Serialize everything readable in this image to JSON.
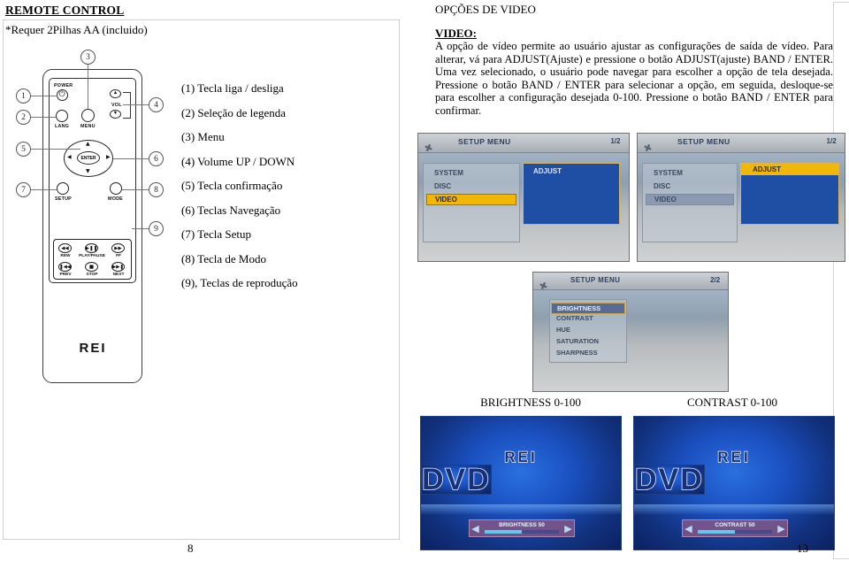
{
  "left": {
    "heading": "REMOTE CONTROL",
    "subheading": "*Requer 2Pilhas AA (incluido)",
    "page_number": "8",
    "legend": [
      "(1) Tecla liga / desliga",
      "(2) Seleção de legenda",
      "(3) Menu",
      "(4) Volume UP / DOWN",
      "(5) Tecla confirmação",
      "(6) Teclas Navegação",
      "(7) Tecla Setup",
      "(8) Tecla de Modo",
      "(9), Teclas de reprodução"
    ],
    "callouts": [
      "1",
      "2",
      "3",
      "4",
      "5",
      "6",
      "7",
      "8",
      "9"
    ],
    "remote": {
      "brand": "REI",
      "buttons": {
        "power": "POWER",
        "lang": "LANG",
        "menu": "MENU",
        "vol": "VOL",
        "enter": "ENTER",
        "setup": "SETUP",
        "mode": "MODE",
        "rew": "REW",
        "play_pause": "PLAY/PAUSE",
        "ff": "FF",
        "prev": "PREV",
        "stop": "STOP",
        "next": "NEXT"
      },
      "glyphs": {
        "power": "⏻",
        "up": "▲",
        "down": "▼",
        "left": "◀",
        "right": "▶",
        "rew": "◀◀",
        "play_pause": "▶❚❚",
        "ff": "▶▶",
        "prev": "❚◀◀",
        "stop": "■",
        "next": "▶▶❚"
      }
    }
  },
  "right": {
    "heading": "OPÇÕES DE VIDEO",
    "section_label": "VIDEO",
    "paragraph": "A opção de vídeo permite ao usuário ajustar as configurações de saída de vídeo. Para alterar, vá para ADJUST(Ajuste) e pressione o botão ADJUST(ajuste) BAND / ENTER. Uma vez selecionado, o usuário pode navegar para escolher a opção de tela desejada. Pressione o botão BAND / ENTER para selecionar a opção, em seguida, desloque-se para escolher a configuração desejada 0-100. Pressione o botão BAND / ENTER para confirmar.",
    "page_number": "13",
    "screens": [
      {
        "title": "SETUP MENU",
        "page_indicator": "1/2",
        "menu_items": [
          "SYSTEM",
          "DISC",
          "VIDEO"
        ],
        "highlighted_menu": "VIDEO",
        "panel_label": "ADJUST",
        "panel_highlighted": false
      },
      {
        "title": "SETUP MENU",
        "page_indicator": "1/2",
        "menu_items": [
          "SYSTEM",
          "DISC",
          "VIDEO"
        ],
        "highlighted_menu": "",
        "panel_label": "ADJUST",
        "panel_highlighted": true
      },
      {
        "title": "SETUP MENU",
        "page_indicator": "2/2",
        "menu_items": [
          "BRIGHTNESS",
          "CONTRAST",
          "HUE",
          "SATURATION",
          "SHARPNESS"
        ],
        "highlighted_menu": "BRIGHTNESS",
        "panel_label": "",
        "panel_highlighted": false
      }
    ],
    "captions": [
      "BRIGHTNESS 0-100",
      "CONTRAST 0-100"
    ],
    "dvd_screens": [
      {
        "logo_top": "REI",
        "logo_main": "DVD",
        "slider_label": "BRIGHTNESS 50",
        "slider_value": 50,
        "arrow_left": "◀",
        "arrow_right": "▶"
      },
      {
        "logo_top": "REI",
        "logo_main": "DVD",
        "slider_label": "CONTRAST 50",
        "slider_value": 50,
        "arrow_left": "◀",
        "arrow_right": "▶"
      }
    ]
  },
  "colors": {
    "highlight": "#f2b705",
    "panel_blue": "#1f4fa5",
    "slider_fill": "#63c8f0"
  }
}
